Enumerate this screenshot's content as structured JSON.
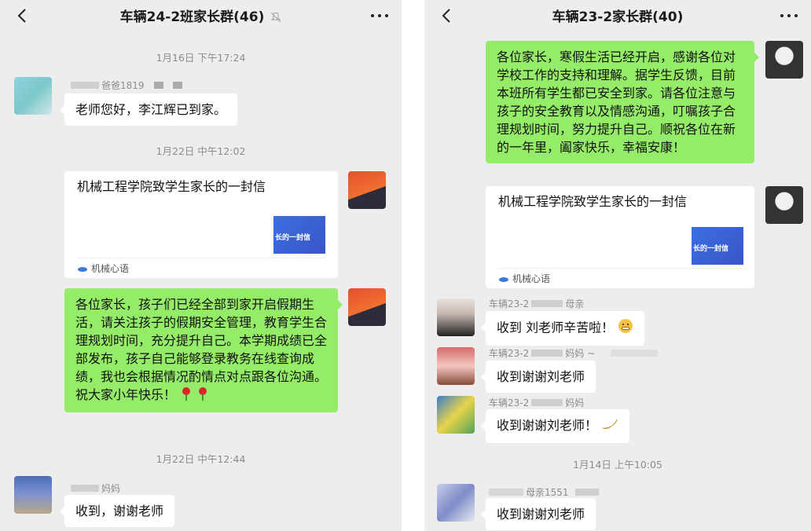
{
  "left_chat": {
    "title": "车辆24-2班家长群(46)",
    "times": [
      "1月16日 下午17:24",
      "1月22日 中午12:02",
      "1月22日 中午12:44"
    ],
    "msg1": {
      "sender": "爸爸1819",
      "text": "老师您好，李江辉已到家。"
    },
    "card": {
      "title": "机械工程学院致学生家长的一封信",
      "thumb_text": "长的一封信",
      "source": "机械心语"
    },
    "announcement": "各位家长，孩子们已经全部到家开启假期生活，请关注孩子的假期安全管理，教育学生合理规划时间，充分提升自己。本学期成绩已全部发布，孩子自己能够登录教务在线查询成绩，我也会根据情况酌情点对点跟各位沟通。祝大家小年快乐！",
    "msg2": {
      "sender": "妈妈",
      "text": "收到，谢谢老师"
    }
  },
  "right_chat": {
    "title": "车辆23-2家长群(40)",
    "announcement": "各位家长，寒假生活已经开启，感谢各位对学校工作的支持和理解。据学生反馈，目前本班所有学生都已安全到家。请各位注意与孩子的安全教育以及情感沟通，叮嘱孩子合理规划时间，努力提升自己。顺祝各位在新的一年里，阖家快乐，幸福安康！",
    "card": {
      "title": "机械工程学院致学生家长的一封信",
      "thumb_text": "长的一封信",
      "source": "机械心语"
    },
    "replies": [
      {
        "sender": "车辆23-2",
        "sender_suffix": "母亲",
        "text": "收到 刘老师辛苦啦！"
      },
      {
        "sender": "车辆23-2",
        "sender_suffix": "妈妈 ~",
        "text": "收到谢谢刘老师"
      },
      {
        "sender": "车辆23-2",
        "sender_suffix": "妈妈",
        "text": "收到谢谢刘老师！"
      }
    ],
    "time": "1月14日 上午10:05",
    "last": {
      "sender": "母亲1551",
      "text": "收到谢谢刘老师"
    }
  }
}
